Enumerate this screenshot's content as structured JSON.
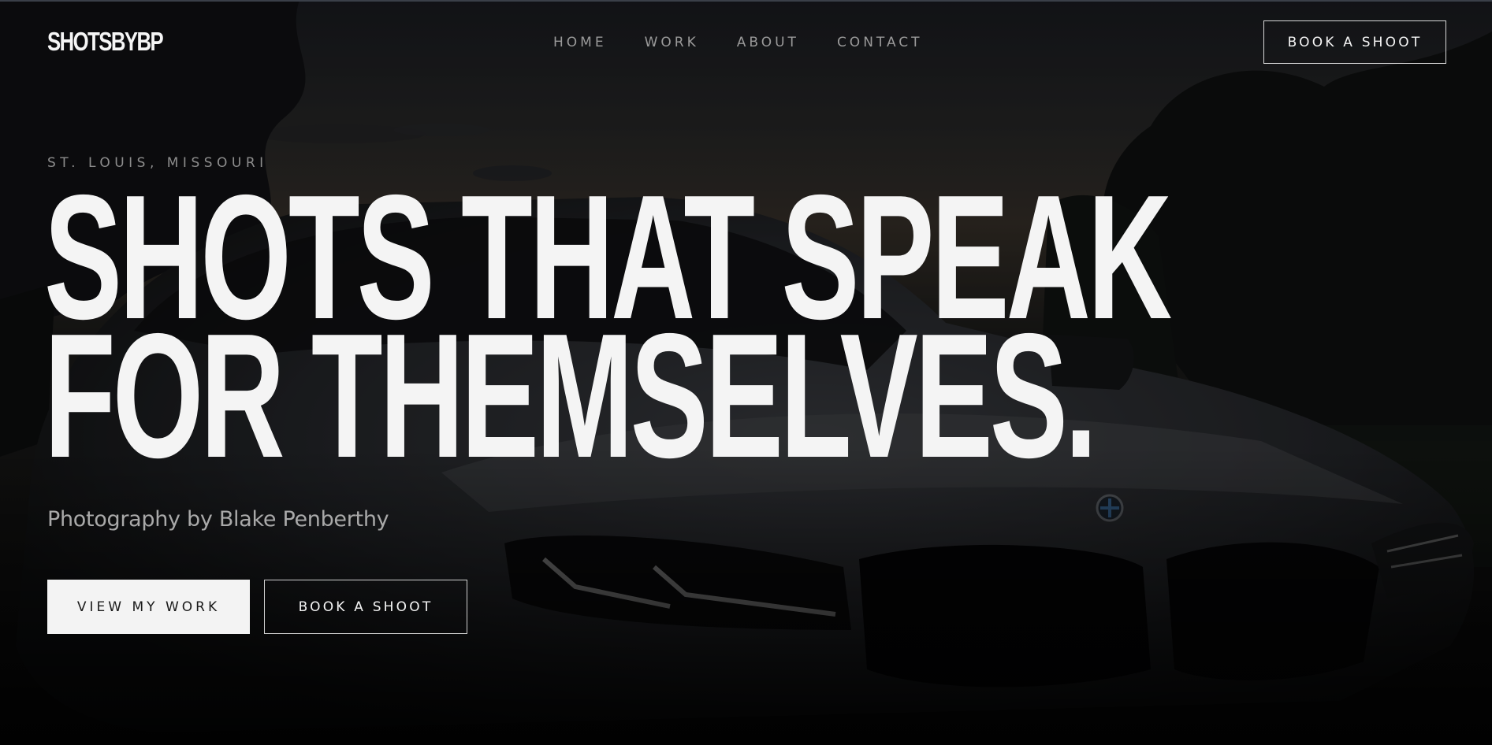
{
  "brand": {
    "logo_text": "SHOTSBYBP"
  },
  "nav": {
    "items": [
      {
        "label": "HOME"
      },
      {
        "label": "WORK"
      },
      {
        "label": "ABOUT"
      },
      {
        "label": "CONTACT"
      }
    ],
    "cta_label": "BOOK A SHOOT"
  },
  "hero": {
    "location": "ST. LOUIS, MISSOURI",
    "headline_line1": "SHOTS THAT SPEAK",
    "headline_line2": "FOR THEMSELVES.",
    "subtitle": "Photography by Blake Penberthy",
    "primary_button": "VIEW MY WORK",
    "secondary_button": "BOOK A SHOOT"
  },
  "colors": {
    "background": "#0a0a0b",
    "text": "#f4f4f4",
    "muted_text": "#9a9a9a",
    "button_fill": "#f3f3f3"
  }
}
